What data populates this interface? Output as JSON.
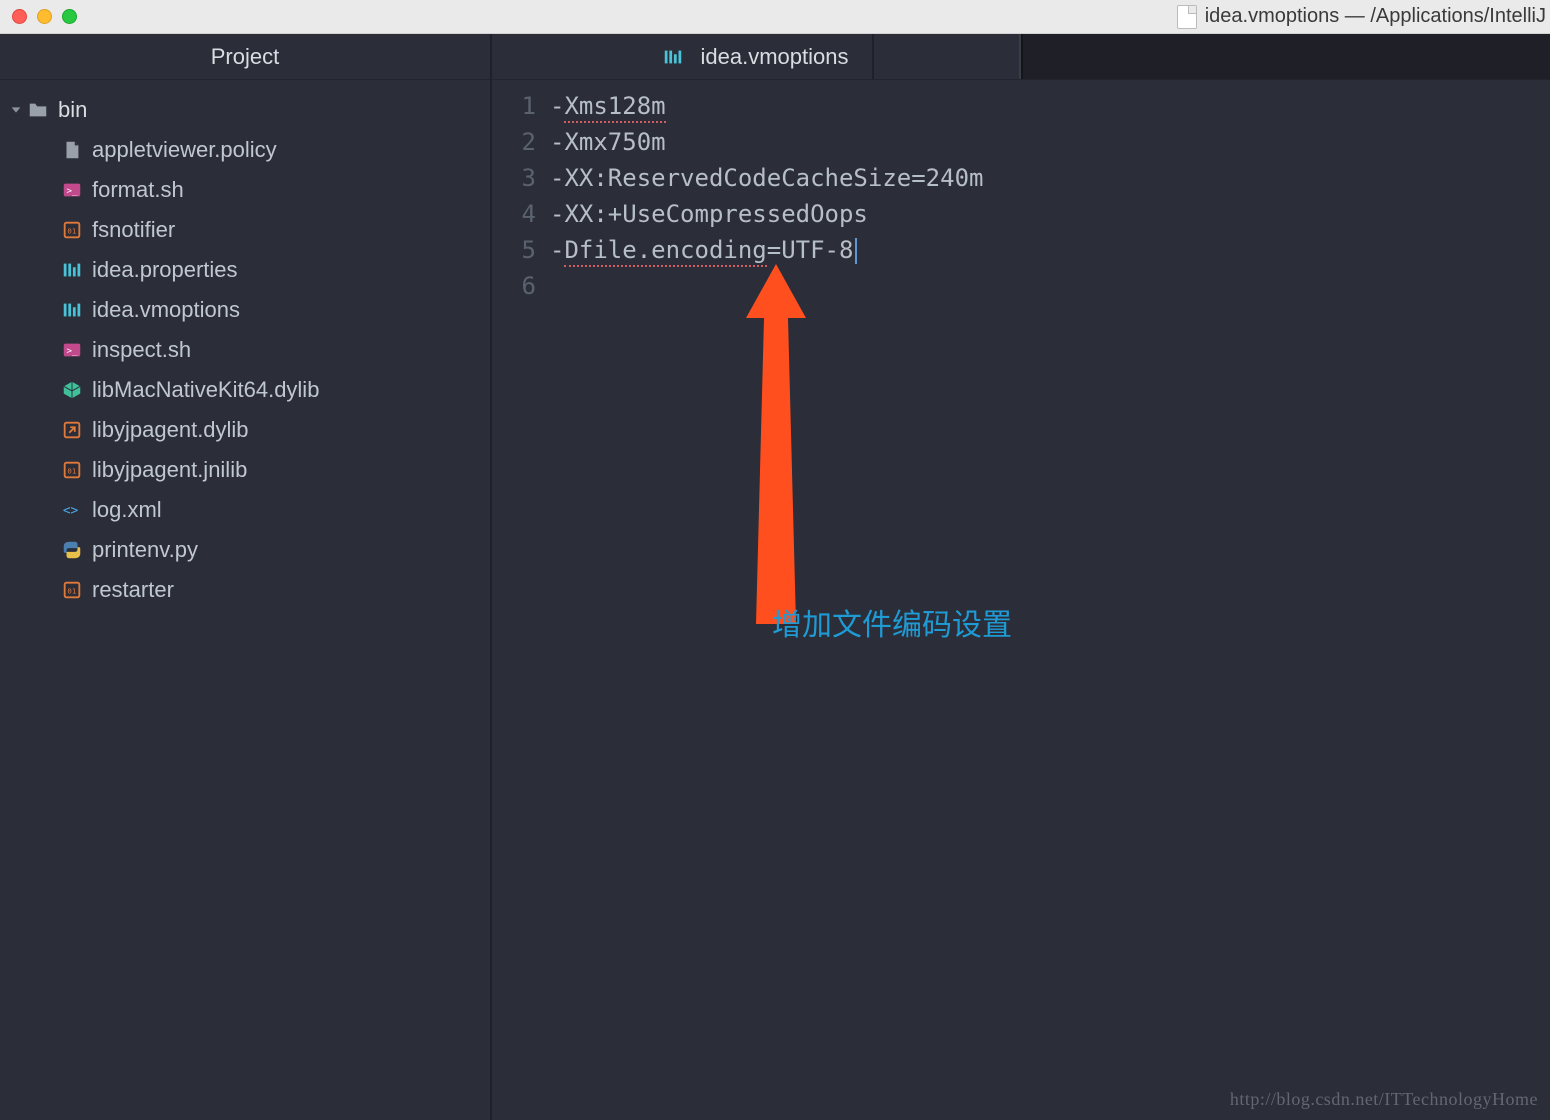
{
  "window": {
    "title": "idea.vmoptions — /Applications/IntelliJ"
  },
  "sidebar": {
    "header": "Project",
    "root": {
      "name": "bin",
      "expanded": true
    },
    "files": [
      {
        "name": "appletviewer.policy",
        "icon": "file"
      },
      {
        "name": "format.sh",
        "icon": "sh"
      },
      {
        "name": "fsnotifier",
        "icon": "bin"
      },
      {
        "name": "idea.properties",
        "icon": "props"
      },
      {
        "name": "idea.vmoptions",
        "icon": "props"
      },
      {
        "name": "inspect.sh",
        "icon": "sh"
      },
      {
        "name": "libMacNativeKit64.dylib",
        "icon": "pkg"
      },
      {
        "name": "libyjpagent.dylib",
        "icon": "link"
      },
      {
        "name": "libyjpagent.jnilib",
        "icon": "bin"
      },
      {
        "name": "log.xml",
        "icon": "xml"
      },
      {
        "name": "printenv.py",
        "icon": "py"
      },
      {
        "name": "restarter",
        "icon": "bin"
      }
    ]
  },
  "editor": {
    "tab_icon": "props",
    "tab_label": "idea.vmoptions",
    "lines": [
      "-Xms128m",
      "-Xmx750m",
      "-XX:ReservedCodeCacheSize=240m",
      "-XX:+UseCompressedOops",
      "-Dfile.encoding=UTF-8",
      ""
    ],
    "line_numbers": [
      "1",
      "2",
      "3",
      "4",
      "5",
      "6"
    ],
    "spell_segments": {
      "0": "Xms128m",
      "4": "Dfile.encoding"
    }
  },
  "annotation": {
    "text": "增加文件编码设置"
  },
  "watermark": "http://blog.csdn.net/ITTechnologyHome"
}
